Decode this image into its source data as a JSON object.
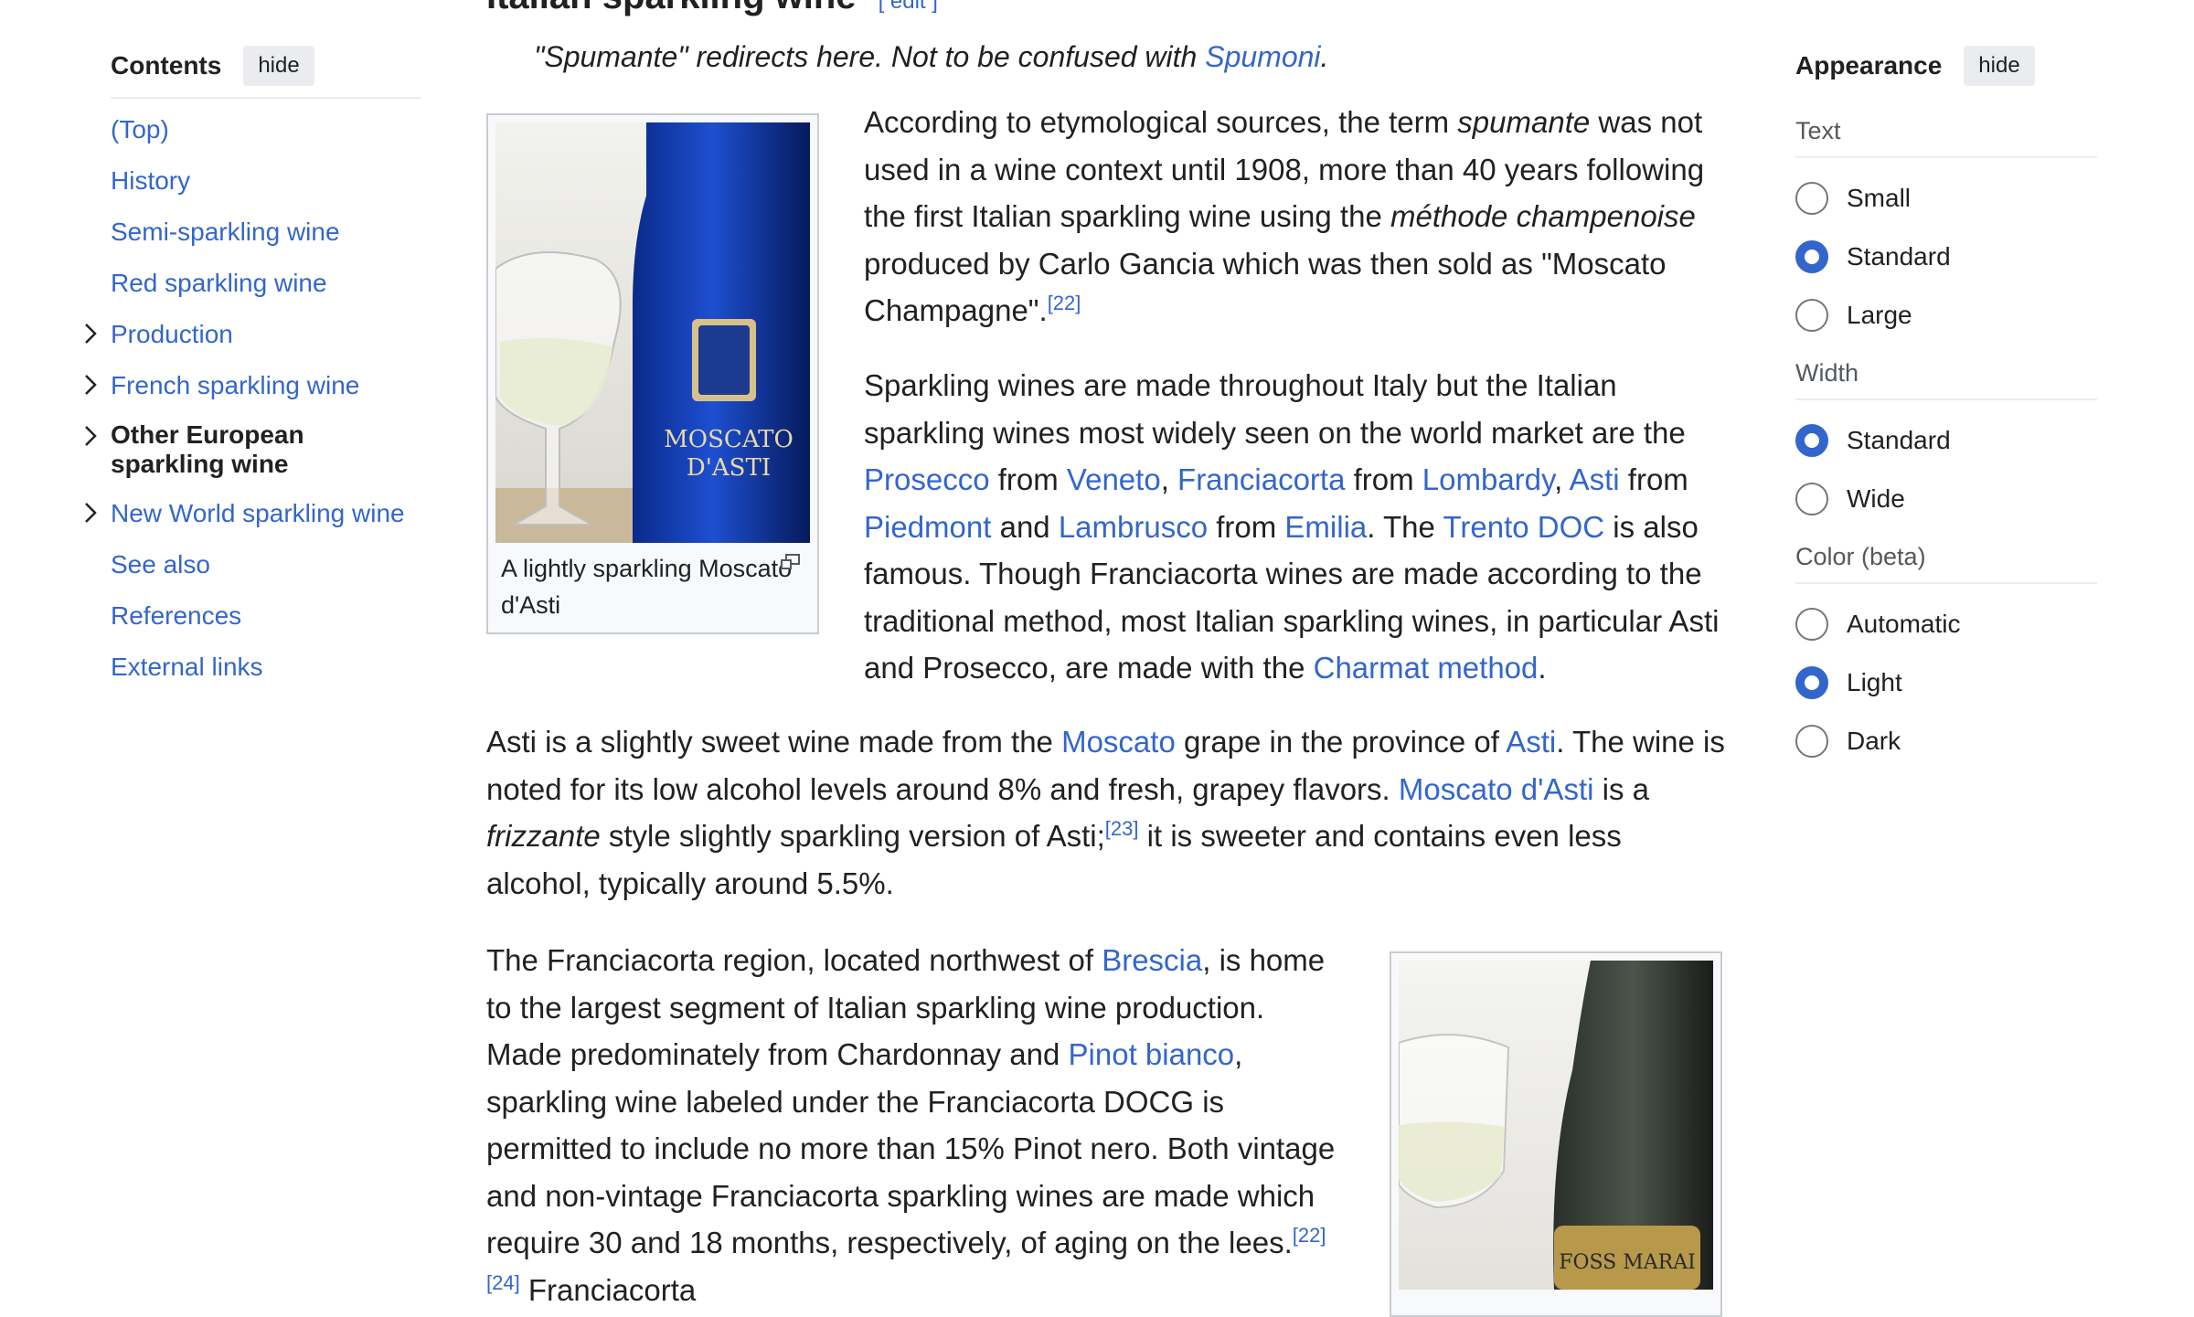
{
  "toc": {
    "title": "Contents",
    "hide_label": "hide",
    "items": [
      {
        "label": "(Top)"
      },
      {
        "label": "History"
      },
      {
        "label": "Semi-sparkling wine"
      },
      {
        "label": "Red sparkling wine"
      },
      {
        "label": "Production"
      },
      {
        "label": "French sparkling wine"
      },
      {
        "label": "Other European sparkling wine"
      },
      {
        "label": "New World sparkling wine"
      },
      {
        "label": "See also"
      },
      {
        "label": "References"
      },
      {
        "label": "External links"
      }
    ]
  },
  "article": {
    "section_heading": "Italian sparkling wine",
    "edit_label": "[ edit ]",
    "hatnote": {
      "pre": "\"Spumante\" redirects here. Not to be confused with ",
      "link": "Spumoni",
      "post": "."
    },
    "figure1_caption": "A lightly sparkling Moscato d'Asti",
    "para1": {
      "t1": "According to etymological sources, the term ",
      "i1": "spumante",
      "t2": " was not used in a wine context until 1908, more than 40 years following the first Italian sparkling wine using the ",
      "i2": "méthode champenoise",
      "t3": " produced by Carlo Gancia which was then sold as \"Moscato Champagne\".",
      "ref": "[22]"
    },
    "para2": {
      "t1": "Sparkling wines are made throughout Italy but the Italian sparkling wines most widely seen on the world market are the ",
      "l1": "Prosecco",
      "t2": " from ",
      "l2": "Veneto",
      "t3": ", ",
      "l3": "Franciacorta",
      "t4": " from ",
      "l4": "Lombardy",
      "t5": ", ",
      "l5": "Asti",
      "t6": " from ",
      "l6": "Piedmont",
      "t7": " and ",
      "l7": "Lambrusco",
      "t8": " from ",
      "l8": "Emilia",
      "t9": ". The ",
      "l9": "Trento DOC",
      "t10": " is also famous. Though Franciacorta wines are made according to the traditional method, most Italian sparkling wines, in particular Asti and Prosecco, are made with the ",
      "l10": "Charmat method",
      "t11": "."
    },
    "para3": {
      "t1": "Asti is a slightly sweet wine made from the ",
      "l1": "Moscato",
      "t2": " grape in the province of ",
      "l2": "Asti",
      "t3": ". The wine is noted for its low alcohol levels around 8% and fresh, grapey flavors. ",
      "l3": "Moscato d'Asti",
      "t4": " is a ",
      "i1": "frizzante",
      "t5": " style slightly sparkling version of Asti;",
      "ref": "[23]",
      "t6": " it is sweeter and contains even less alcohol, typically around 5.5%."
    },
    "para4": {
      "t1": "The Franciacorta region, located northwest of ",
      "l1": "Brescia",
      "t2": ", is home to the largest segment of Italian sparkling wine production. Made predominately from Chardonnay and ",
      "l2": "Pinot bianco",
      "t3": ", sparkling wine labeled under the Franciacorta DOCG is permitted to include no more than 15% Pinot nero. Both vintage and non-vintage Franciacorta sparkling wines are made which require 30 and 18 months, respectively, of aging on the lees.",
      "ref": "[22][24]",
      "t4": " Franciacorta"
    },
    "bottle1_label": {
      "line1": "MOSCATO",
      "line2": "D'ASTI"
    },
    "bottle2_label": "FOSS MARAI"
  },
  "appearance": {
    "title": "Appearance",
    "hide_label": "hide",
    "text_label": "Text",
    "text_options": [
      {
        "label": "Small"
      },
      {
        "label": "Standard"
      },
      {
        "label": "Large"
      }
    ],
    "text_selected": "Standard",
    "width_label": "Width",
    "width_options": [
      {
        "label": "Standard"
      },
      {
        "label": "Wide"
      }
    ],
    "width_selected": "Standard",
    "color_label": "Color (beta)",
    "color_options": [
      {
        "label": "Automatic"
      },
      {
        "label": "Light"
      },
      {
        "label": "Dark"
      }
    ],
    "color_selected": "Light"
  },
  "colors": {
    "link": "#3366cc",
    "radio_selected": "#3366cc",
    "text": "#202122"
  }
}
